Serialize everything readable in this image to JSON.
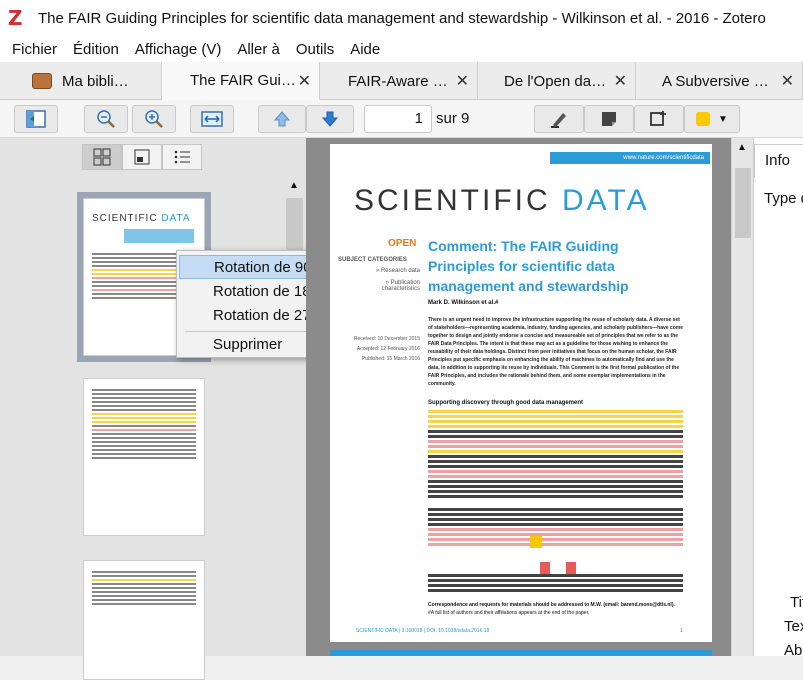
{
  "window": {
    "title": "The FAIR Guiding Principles for scientific data management and stewardship - Wilkinson et al. - 2016 - Zotero",
    "app_logo": "Z"
  },
  "menu": [
    "Fichier",
    "Édition",
    "Affichage (V)",
    "Aller à",
    "Outils",
    "Aide"
  ],
  "tabs": [
    {
      "label": "Ma bibli…",
      "closable": false
    },
    {
      "label": "The FAIR Gui…",
      "closable": true
    },
    {
      "label": "FAIR-Aware …",
      "closable": true
    },
    {
      "label": "De l'Open da…",
      "closable": true
    },
    {
      "label": "A Subversive …",
      "closable": true
    }
  ],
  "tab_close": "✕",
  "toolbar": {
    "page_number": "1",
    "page_total": "sur 9",
    "highlight_color": "#f7c900"
  },
  "context_menu": {
    "items": [
      "Rotation de 90°",
      "Rotation de 180°",
      "Rotation de 270°",
      "Supprimer"
    ],
    "hovered_index": 0
  },
  "right_panel": {
    "tab": "Info",
    "type_label": "Type d",
    "fields": [
      "Tit",
      "Tex",
      "Ab"
    ]
  },
  "pdf_page": {
    "url": "www.nature.com/scientificdata",
    "journal_word1": "SCIENTIFIC",
    "journal_word2": "DATA",
    "open_label": "OPEN",
    "subject_heading": "SUBJECT CATEGORIES",
    "subject_items": [
      "» Research data",
      "» Publication characteristics"
    ],
    "title": "Comment: The FAIR Guiding Principles for scientific data management and stewardship",
    "author": "Mark D. Wilkinson et al.#",
    "dates": [
      "Received: 10 December 2015",
      "Accepted: 12 February 2016",
      "Published: 15 March 2016"
    ],
    "abstract": "There is an urgent need to improve the infrastructure supporting the reuse of scholarly data. A diverse set of stakeholders—representing academia, industry, funding agencies, and scholarly publishers—have come together to design and jointly endorse a concise and measureable set of principles that we refer to as the FAIR Data Principles. The intent is that these may act as a guideline for those wishing to enhance the reusability of their data holdings. Distinct from peer initiatives that focus on the human scholar, the FAIR Principles put specific emphasis on enhancing the ability of machines to automatically find and use the data, in addition to supporting its reuse by individuals. This Comment is the first formal publication of the FAIR Principles, and includes the rationale behind them, and some exemplar implementations in the community.",
    "section_heading": "Supporting discovery through good data management",
    "footer": "SCIENTIFIC DATA | 3:160018 | DOI: 10.1038/sdata.2016.18",
    "page_num": "1",
    "correspondence": "Correspondence and requests for materials should be addressed to M.W. (email: barend.mons@dtls.nl).",
    "footnote": "#A full list of authors and their affiliations appears at the end of the paper."
  }
}
